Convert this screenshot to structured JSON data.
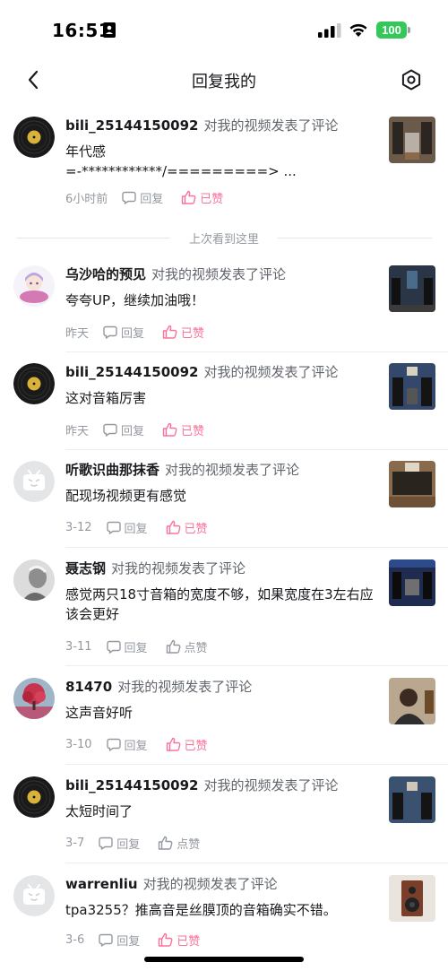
{
  "status_bar": {
    "time": "16:51",
    "battery": "100"
  },
  "nav": {
    "title": "回复我的"
  },
  "separator": {
    "label": "上次看到这里"
  },
  "actions": {
    "reply": "回复",
    "liked": "已赞",
    "like": "点赞"
  },
  "colors": {
    "accent_pink": "#fb7299",
    "meta_gray": "#9499a0",
    "battery_green": "#34c759"
  },
  "replies": [
    {
      "username": "bili_25144150092",
      "action": "对我的视频发表了评论",
      "text": "年代感\n=-************/=========> ...",
      "time": "6小时前",
      "liked": true,
      "avatar": "vinyl-record",
      "thumb": "hifi-room"
    },
    {
      "username": "乌沙哈的预见",
      "action": "对我的视频发表了评论",
      "text": "夸夸UP，继续加油哦！",
      "time": "昨天",
      "liked": true,
      "avatar": "anime-character",
      "thumb": "speaker-room-dark"
    },
    {
      "username": "bili_25144150092",
      "action": "对我的视频发表了评论",
      "text": "这对音箱厉害",
      "time": "昨天",
      "liked": true,
      "avatar": "vinyl-record",
      "thumb": "speaker-stage"
    },
    {
      "username": "听歌识曲那抹香",
      "action": "对我的视频发表了评论",
      "text": "配现场视频更有感觉",
      "time": "3-12",
      "liked": true,
      "avatar": "default-tv",
      "thumb": "speaker-wall"
    },
    {
      "username": "聂志钢",
      "action": "对我的视频发表了评论",
      "text": "感觉两只18寸音箱的宽度不够，如果宽度在3左右应该会更好",
      "time": "3-11",
      "liked": false,
      "avatar": "portrait-gray",
      "thumb": "expo-stage"
    },
    {
      "username": "81470",
      "action": "对我的视频发表了评论",
      "text": "这声音好听",
      "time": "3-10",
      "liked": true,
      "avatar": "red-tree",
      "thumb": "person-listening"
    },
    {
      "username": "bili_25144150092",
      "action": "对我的视频发表了评论",
      "text": "太短时间了",
      "time": "3-7",
      "liked": false,
      "avatar": "vinyl-record",
      "thumb": "speaker-stage-2"
    },
    {
      "username": "warrenliu",
      "action": "对我的视频发表了评论",
      "text": "tpa3255？推高音是丝膜顶的音箱确实不错。",
      "time": "3-6",
      "liked": true,
      "avatar": "default-tv",
      "thumb": "bookshelf-speaker"
    }
  ]
}
